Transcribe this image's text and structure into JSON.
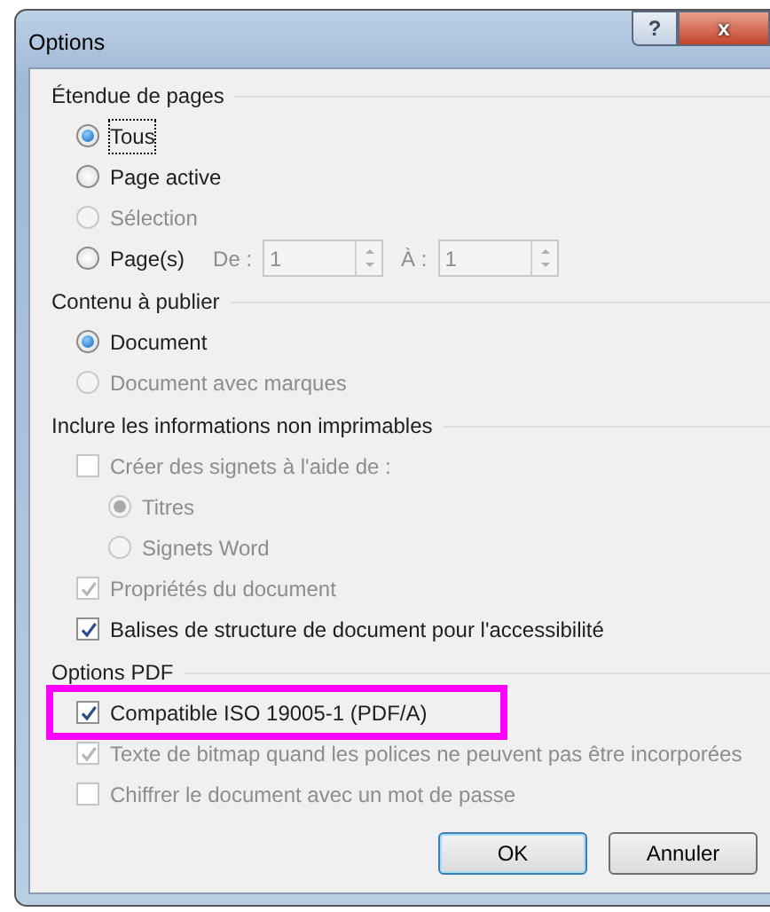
{
  "window": {
    "title": "Options",
    "buttons": [
      {
        "kind": "help",
        "label": "?"
      },
      {
        "kind": "close",
        "label": "x"
      }
    ]
  },
  "sections": [
    {
      "heading": "Étendue de pages",
      "items": [
        {
          "kind": "radio",
          "label": "Tous",
          "selected": true,
          "disabled": false,
          "focused": true
        },
        {
          "kind": "radio",
          "label": "Page active",
          "selected": false,
          "disabled": false,
          "focused": false
        },
        {
          "kind": "radio",
          "label": "Sélection",
          "selected": false,
          "disabled": true,
          "focused": false
        },
        {
          "kind": "radio",
          "label": "Page(s)",
          "selected": false,
          "disabled": false,
          "focused": false,
          "range": {
            "from_label": "De :",
            "from_value": "1",
            "to_label": "À :",
            "to_value": "1",
            "disabled": true
          }
        }
      ]
    },
    {
      "heading": "Contenu à publier",
      "items": [
        {
          "kind": "radio",
          "label": "Document",
          "selected": true,
          "disabled": false,
          "focused": false
        },
        {
          "kind": "radio",
          "label": "Document avec marques",
          "selected": false,
          "disabled": true,
          "focused": false
        }
      ]
    },
    {
      "heading": "Inclure les informations non imprimables",
      "items": [
        {
          "kind": "checkbox",
          "label": "Créer des signets à l'aide de :",
          "checked": false,
          "disabled": true,
          "focused": false,
          "children": [
            {
              "kind": "radio",
              "label": "Titres",
              "selected": true,
              "disabled": true,
              "focused": false
            },
            {
              "kind": "radio",
              "label": "Signets Word",
              "selected": false,
              "disabled": true,
              "focused": false
            }
          ]
        },
        {
          "kind": "checkbox",
          "label": "Propriétés du document",
          "checked": true,
          "disabled": true,
          "focused": false
        },
        {
          "kind": "checkbox",
          "label": "Balises de structure de document pour l'accessibilité",
          "checked": true,
          "disabled": false,
          "focused": false
        }
      ]
    },
    {
      "heading": "Options PDF",
      "items": [
        {
          "kind": "checkbox",
          "label": "Compatible ISO 19005-1 (PDF/A)",
          "checked": true,
          "disabled": false,
          "focused": false,
          "highlighted": true
        },
        {
          "kind": "checkbox",
          "label": "Texte de bitmap quand les polices ne peuvent pas être incorporées",
          "checked": true,
          "disabled": true,
          "focused": false
        },
        {
          "kind": "checkbox",
          "label": "Chiffrer le document avec un mot de passe",
          "checked": false,
          "disabled": true,
          "focused": false
        }
      ]
    }
  ],
  "buttons": [
    {
      "label": "OK",
      "default": true
    },
    {
      "label": "Annuler",
      "default": false
    }
  ]
}
